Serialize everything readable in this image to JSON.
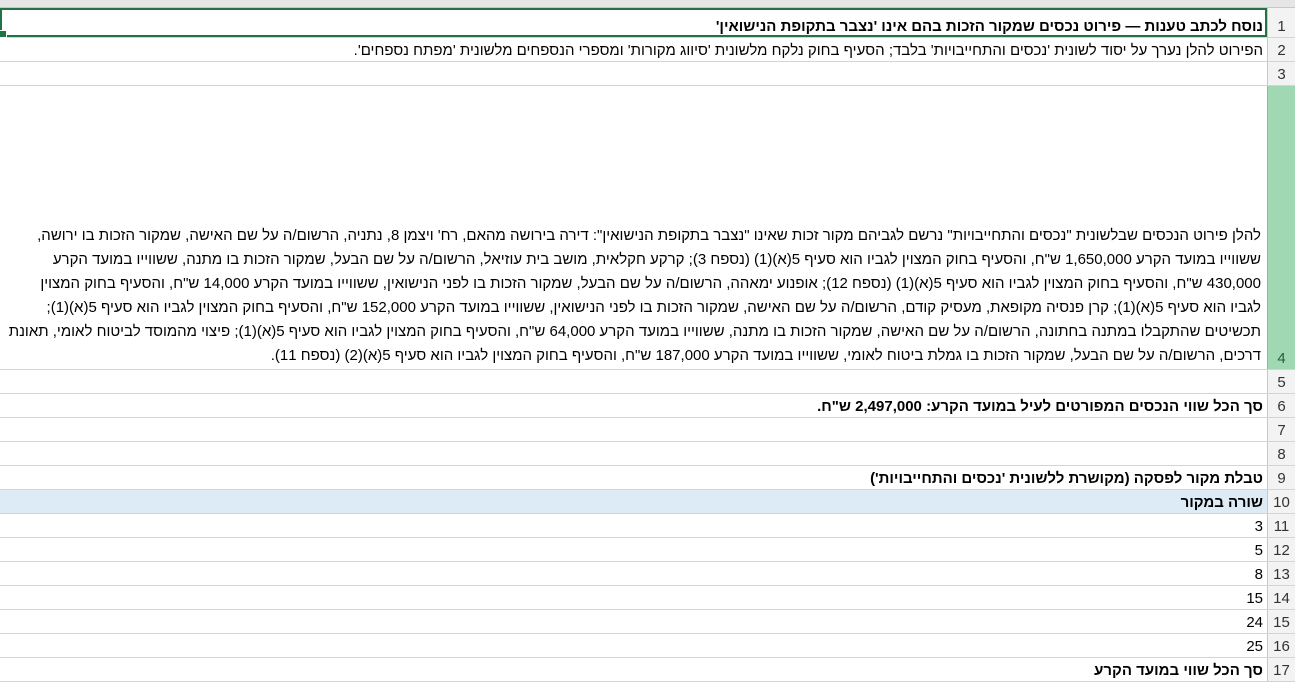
{
  "sheet": {
    "rows": [
      {
        "num": "1",
        "text": "נוסח לכתב טענות — פירוט נכסים שמקור הזכות בהם אינו 'נצבר בתקופת הנישואין'",
        "bold": true,
        "active": true
      },
      {
        "num": "2",
        "text": "הפירוט להלן נערך על יסוד לשונית 'נכסים והתחייבויות' בלבד; הסעיף בחוק נלקח מלשונית 'סיווג מקורות' ומספרי הנספחים מלשונית 'מפתח נספחים'.",
        "bold": false
      },
      {
        "num": "3",
        "text": "",
        "bold": false
      },
      {
        "num": "4",
        "text": "להלן פירוט הנכסים שבלשונית \"נכסים והתחייבויות\" נרשם לגביהם מקור זכות שאינו \"נצבר בתקופת הנישואין\": דירה בירושה מהאם, רח' ויצמן 8, נתניה, הרשום/ה על שם האישה, שמקור הזכות בו ירושה, ששווייו במועד הקרע 1,650,000 ש\"ח, והסעיף בחוק המצוין לגביו הוא סעיף 5(א)(1) (נספח 3); קרקע חקלאית, מושב בית עוזיאל, הרשום/ה על שם הבעל, שמקור הזכות בו מתנה, ששווייו במועד הקרע 430,000 ש\"ח, והסעיף בחוק המצוין לגביו הוא סעיף 5(א)(1) (נספח 12); אופנוע ימאהה, הרשום/ה על שם הבעל, שמקור הזכות בו לפני הנישואין, ששווייו במועד הקרע 14,000 ש\"ח, והסעיף בחוק המצוין לגביו הוא סעיף 5(א)(1); קרן פנסיה מקופאת, מעסיק קודם, הרשום/ה על שם האישה, שמקור הזכות בו לפני הנישואין, ששווייו במועד הקרע 152,000 ש\"ח, והסעיף בחוק המצוין לגביו הוא סעיף 5(א)(1); תכשיטים שהתקבלו במתנה בחתונה, הרשום/ה על שם האישה, שמקור הזכות בו מתנה, ששווייו במועד הקרע 64,000 ש\"ח, והסעיף בחוק המצוין לגביו הוא סעיף 5(א)(1); פיצוי מהמוסד לביטוח לאומי, תאונת דרכים, הרשום/ה על שם הבעל, שמקור הזכות בו גמלת ביטוח לאומי, ששווייו במועד הקרע 187,000 ש\"ח, והסעיף בחוק המצוין לגביו הוא סעיף 5(א)(2) (נספח 11).",
        "bold": false,
        "wrap": true,
        "selected": true
      },
      {
        "num": "5",
        "text": "",
        "bold": false
      },
      {
        "num": "6",
        "text": "סך הכל שווי הנכסים המפורטים לעיל במועד הקרע: 2,497,000 ש\"ח.",
        "bold": true
      },
      {
        "num": "7",
        "text": "",
        "bold": false
      },
      {
        "num": "8",
        "text": "",
        "bold": false
      },
      {
        "num": "9",
        "text": "טבלת מקור לפסקה (מקושרת ללשונית 'נכסים והתחייבויות')",
        "bold": true
      },
      {
        "num": "10",
        "text": "שורה במקור",
        "bold": true,
        "header": true
      },
      {
        "num": "11",
        "text": "3",
        "bold": false
      },
      {
        "num": "12",
        "text": "5",
        "bold": false
      },
      {
        "num": "13",
        "text": "8",
        "bold": false
      },
      {
        "num": "14",
        "text": "15",
        "bold": false
      },
      {
        "num": "15",
        "text": "24",
        "bold": false
      },
      {
        "num": "16",
        "text": "25",
        "bold": false
      },
      {
        "num": "17",
        "text": "סך הכל שווי במועד הקרע",
        "bold": true
      }
    ]
  }
}
